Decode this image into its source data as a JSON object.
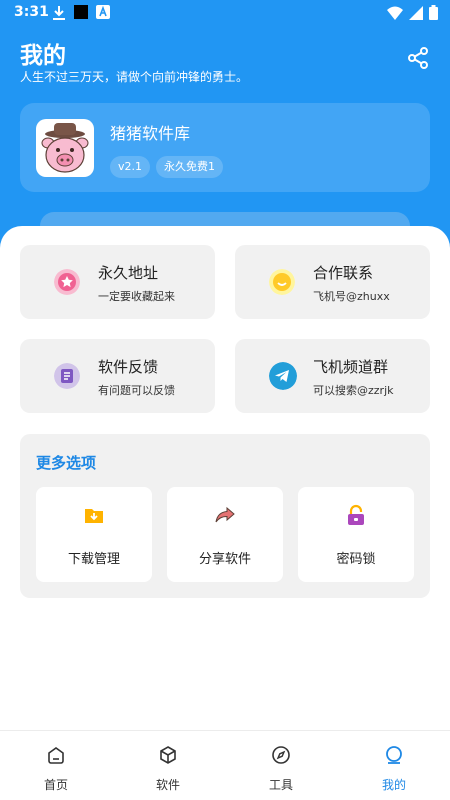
{
  "status_bar": {
    "time": "3:31"
  },
  "header": {
    "title": "我的",
    "subtitle": "人生不过三万天，请做个向前冲锋的勇士。"
  },
  "profile": {
    "name": "猪猪软件库",
    "tags": [
      "v2.1",
      "永久免费1"
    ]
  },
  "tiles": [
    {
      "title": "永久地址",
      "sub": "一定要收藏起来",
      "icon": "star-badge-icon",
      "color": "#f06292"
    },
    {
      "title": "合作联系",
      "sub": "飞机号@zhuxx",
      "icon": "smile-badge-icon",
      "color": "#ffca28"
    },
    {
      "title": "软件反馈",
      "sub": "有问题可以反馈",
      "icon": "feedback-badge-icon",
      "color": "#7e57c2"
    },
    {
      "title": "飞机频道群",
      "sub": "可以搜索@zzrjk",
      "icon": "telegram-icon",
      "color": "#2196f3"
    }
  ],
  "more": {
    "title": "更多选项",
    "items": [
      {
        "label": "下载管理",
        "icon": "download-folder-icon",
        "color": "#ffb300"
      },
      {
        "label": "分享软件",
        "icon": "share-arrow-icon",
        "color": "#e57373"
      },
      {
        "label": "密码锁",
        "icon": "lock-icon",
        "color": "#ab47bc"
      }
    ]
  },
  "nav": {
    "items": [
      {
        "label": "首页",
        "icon": "home-icon"
      },
      {
        "label": "软件",
        "icon": "cube-icon"
      },
      {
        "label": "工具",
        "icon": "compass-icon"
      },
      {
        "label": "我的",
        "icon": "profile-icon"
      }
    ],
    "active_index": 3,
    "active_color": "#1e88e5"
  }
}
